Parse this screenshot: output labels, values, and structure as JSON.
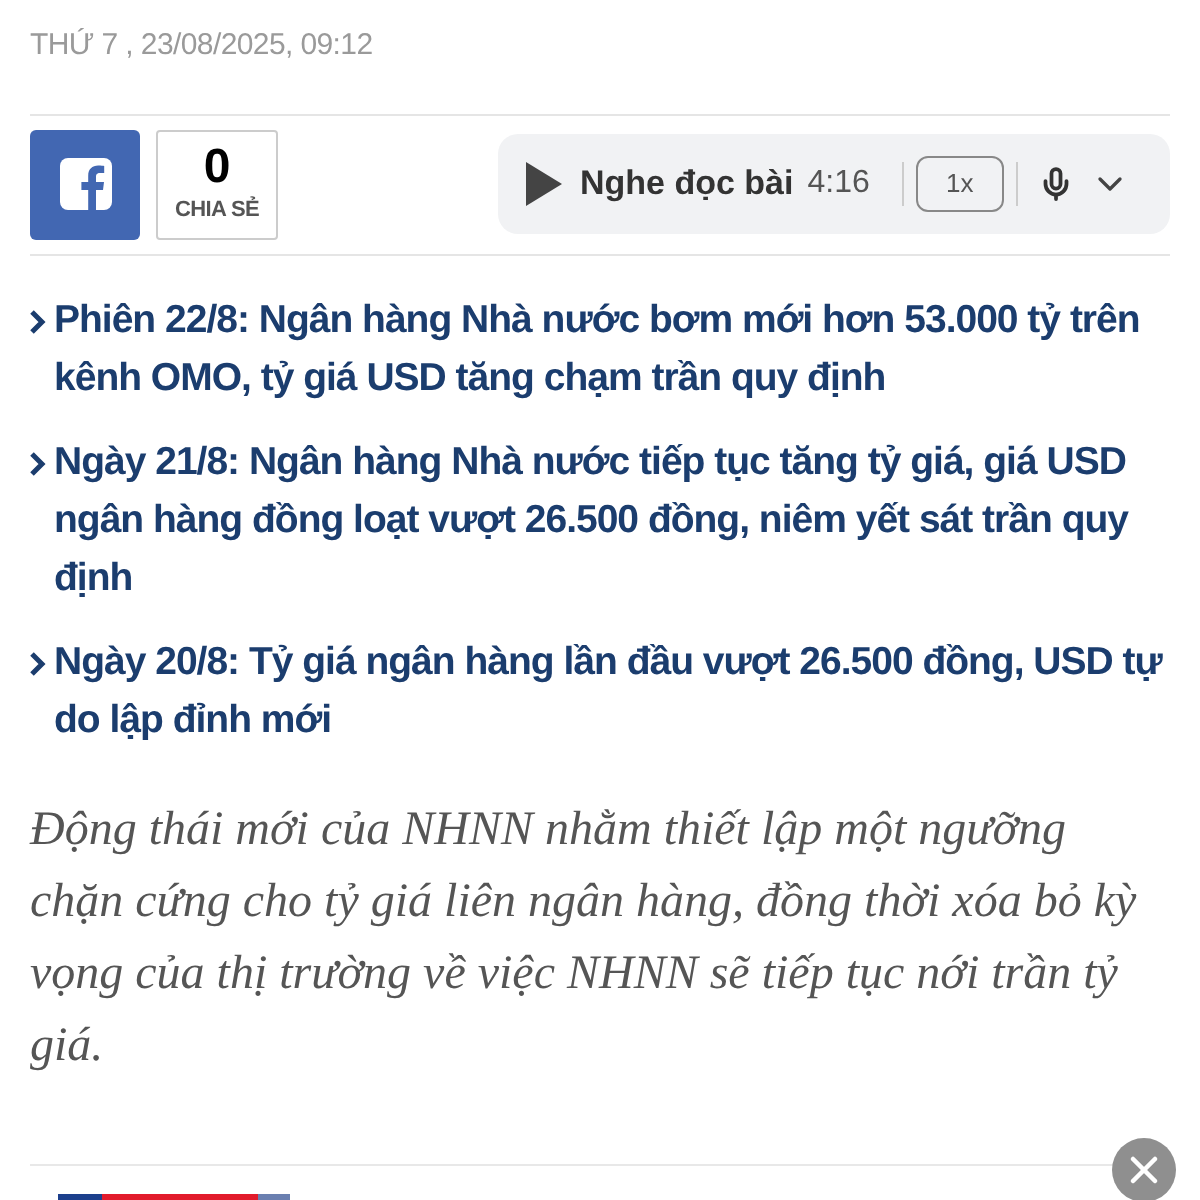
{
  "date": "THỨ 7 , 23/08/2025, 09:12",
  "share": {
    "count": "0",
    "label": "CHIA SẺ"
  },
  "player": {
    "label": "Nghe đọc bài",
    "duration": "4:16",
    "speed": "1x"
  },
  "related": [
    {
      "text": "Phiên 22/8: Ngân hàng Nhà nước bơm mới hơn 53.000 tỷ trên kênh OMO, tỷ giá USD tăng chạm trần quy định"
    },
    {
      "text": "Ngày 21/8: Ngân hàng Nhà nước tiếp tục tăng tỷ giá, giá USD ngân hàng đồng loạt vượt 26.500 đồng, niêm yết sát trần quy định"
    },
    {
      "text": "Ngày 20/8: Tỷ giá ngân hàng lần đầu vượt 26.500 đồng, USD tự do lập đỉnh mới"
    }
  ],
  "lead": "Động thái mới của NHNN nhằm thiết lập một ngưỡng chặn cứng cho tỷ giá liên ngân hàng, đồng thời xóa bỏ kỳ vọng của thị trường về việc NHNN sẽ tiếp tục nới trần tỷ giá."
}
